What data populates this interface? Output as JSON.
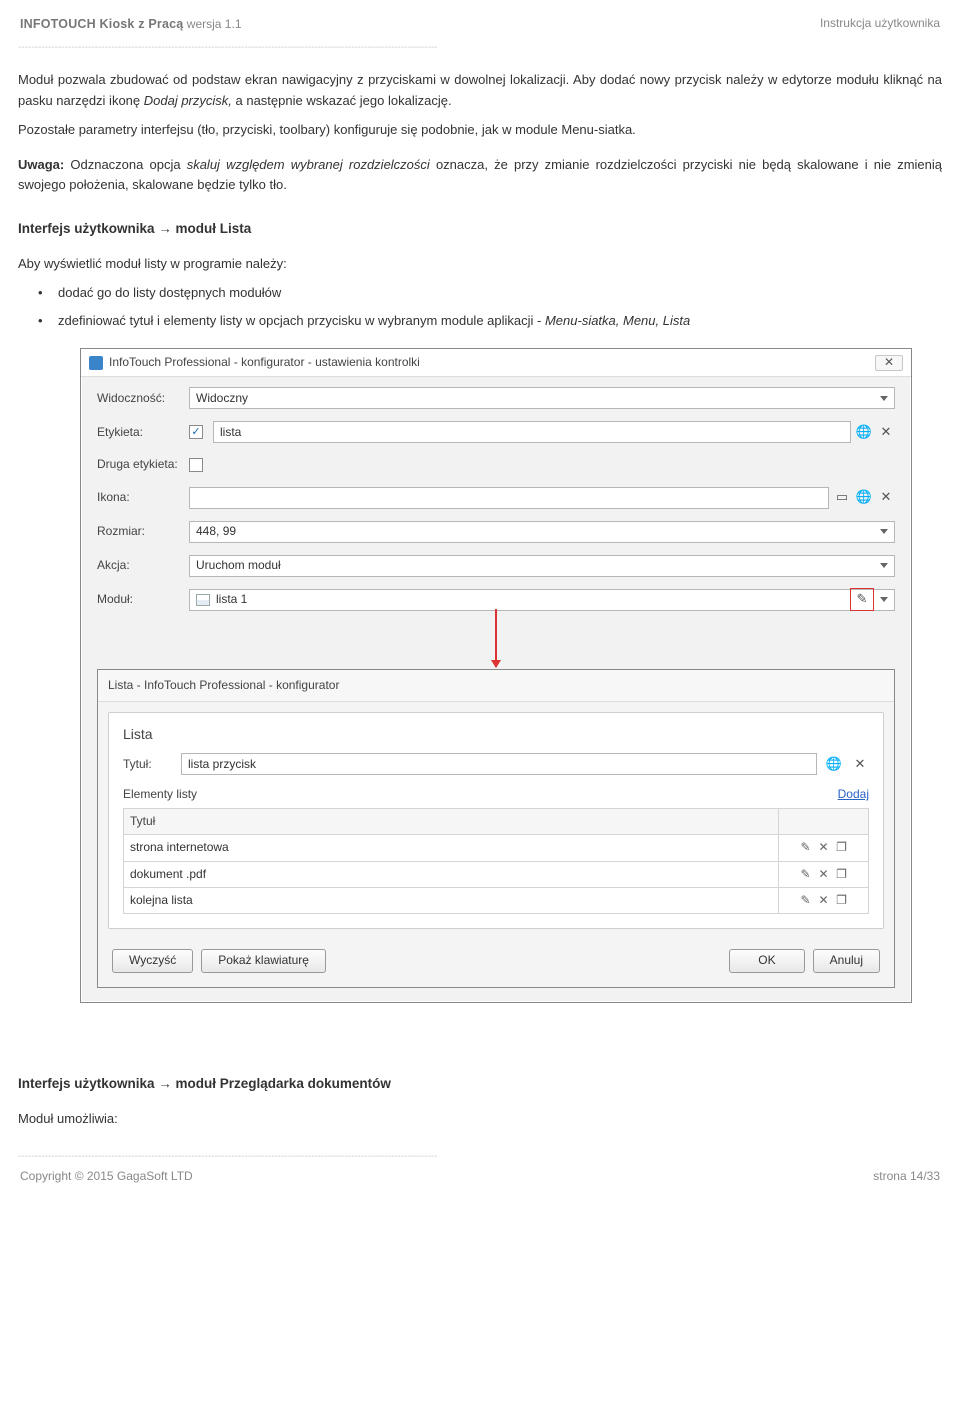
{
  "header": {
    "product": "INFOTOUCH Kiosk z Pracą",
    "version": "wersja 1.1",
    "right": "Instrukcja użytkownika"
  },
  "separator": "------------------------------------------------------------------------------------------------------------------------------",
  "intro": {
    "p1a": "Moduł pozwala zbudować od podstaw ekran nawigacyjny z przyciskami w dowolnej lokalizacji. Aby dodać nowy przycisk należy w edytorze modułu kliknąć na pasku narzędzi ikonę ",
    "p1b": "Dodaj przycisk,",
    "p1c": " a następnie wskazać jego lokalizację.",
    "p2": "Pozostałe parametry interfejsu (tło, przyciski, toolbary) konfiguruje się podobnie, jak w module Menu-siatka.",
    "note_label": "Uwaga:",
    "note_a": " Odznaczona opcja ",
    "note_i": "skaluj względem wybranej rozdzielczości",
    "note_b": " oznacza, że przy zmianie rozdzielczości przyciski nie będą skalowane i nie zmienią swojego położenia, skalowane będzie tylko tło."
  },
  "sec1": "Interfejs użytkownika →  moduł Lista",
  "list_intro": "Aby wyświetlić moduł listy w programie należy:",
  "bullets": [
    "dodać go do listy dostępnych modułów",
    "zdefiniować tytuł i elementy listy w opcjach przycisku w wybranym module aplikacji - Menu-siatka, Menu, Lista"
  ],
  "win1": {
    "title": "InfoTouch Professional - konfigurator - ustawienia kontrolki",
    "rows": {
      "widocznosc_lbl": "Widoczność:",
      "widocznosc_val": "Widoczny",
      "etykieta_lbl": "Etykieta:",
      "etykieta_val": "lista",
      "druga_lbl": "Druga etykieta:",
      "ikona_lbl": "Ikona:",
      "rozmiar_lbl": "Rozmiar:",
      "rozmiar_val": "448, 99",
      "akcja_lbl": "Akcja:",
      "akcja_val": "Uruchom moduł",
      "modul_lbl": "Moduł:",
      "modul_val": "lista 1"
    }
  },
  "win2": {
    "title": "Lista - InfoTouch Professional - konfigurator",
    "panel_h": "Lista",
    "tytul_lbl": "Tytuł:",
    "tytul_val": "lista przycisk",
    "elementy_lbl": "Elementy listy",
    "dodaj": "Dodaj",
    "col": "Tytuł",
    "items": [
      "strona internetowa",
      "dokument .pdf",
      "kolejna lista"
    ],
    "btn_clear": "Wyczyść",
    "btn_kb": "Pokaż klawiaturę",
    "btn_ok": "OK",
    "btn_cancel": "Anuluj"
  },
  "sec2": "Interfejs użytkownika → moduł Przeglądarka dokumentów",
  "sec2_para": "Moduł umożliwia:",
  "footer": {
    "left": "Copyright © 2015 GagaSoft LTD",
    "right": "strona 14/33"
  }
}
